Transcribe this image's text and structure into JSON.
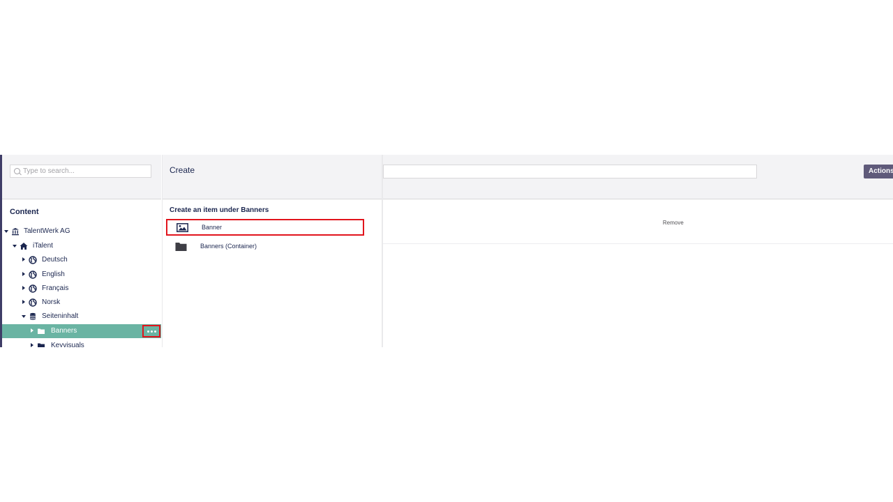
{
  "tree": {
    "search_placeholder": "Type to search...",
    "section_title": "Content",
    "items": [
      {
        "label": "TalentWerk AG",
        "icon": "institution-icon"
      },
      {
        "label": "iTalent",
        "icon": "home-icon"
      },
      {
        "label": "Deutsch",
        "icon": "globe-icon"
      },
      {
        "label": "English",
        "icon": "globe-icon"
      },
      {
        "label": "Français",
        "icon": "globe-icon"
      },
      {
        "label": "Norsk",
        "icon": "globe-icon"
      },
      {
        "label": "Seiteninhalt",
        "icon": "database-icon"
      },
      {
        "label": "Banners",
        "icon": "folder-icon"
      },
      {
        "label": "Keyvisuals",
        "icon": "folder-icon"
      }
    ]
  },
  "create_dialog": {
    "title": "Create",
    "subtitle": "Create an item under Banners",
    "options": [
      {
        "label": "Banner",
        "icon": "picture-icon"
      },
      {
        "label": "Banners (Container)",
        "icon": "folder-icon"
      }
    ]
  },
  "main": {
    "name_value": "",
    "actions_label": "Actions",
    "remove_label": "Remove"
  },
  "colors": {
    "selected_row": "#6ab4a3",
    "highlight": "#e1141c",
    "actions_button": "#5f5a7a",
    "text": "#1b264f"
  }
}
